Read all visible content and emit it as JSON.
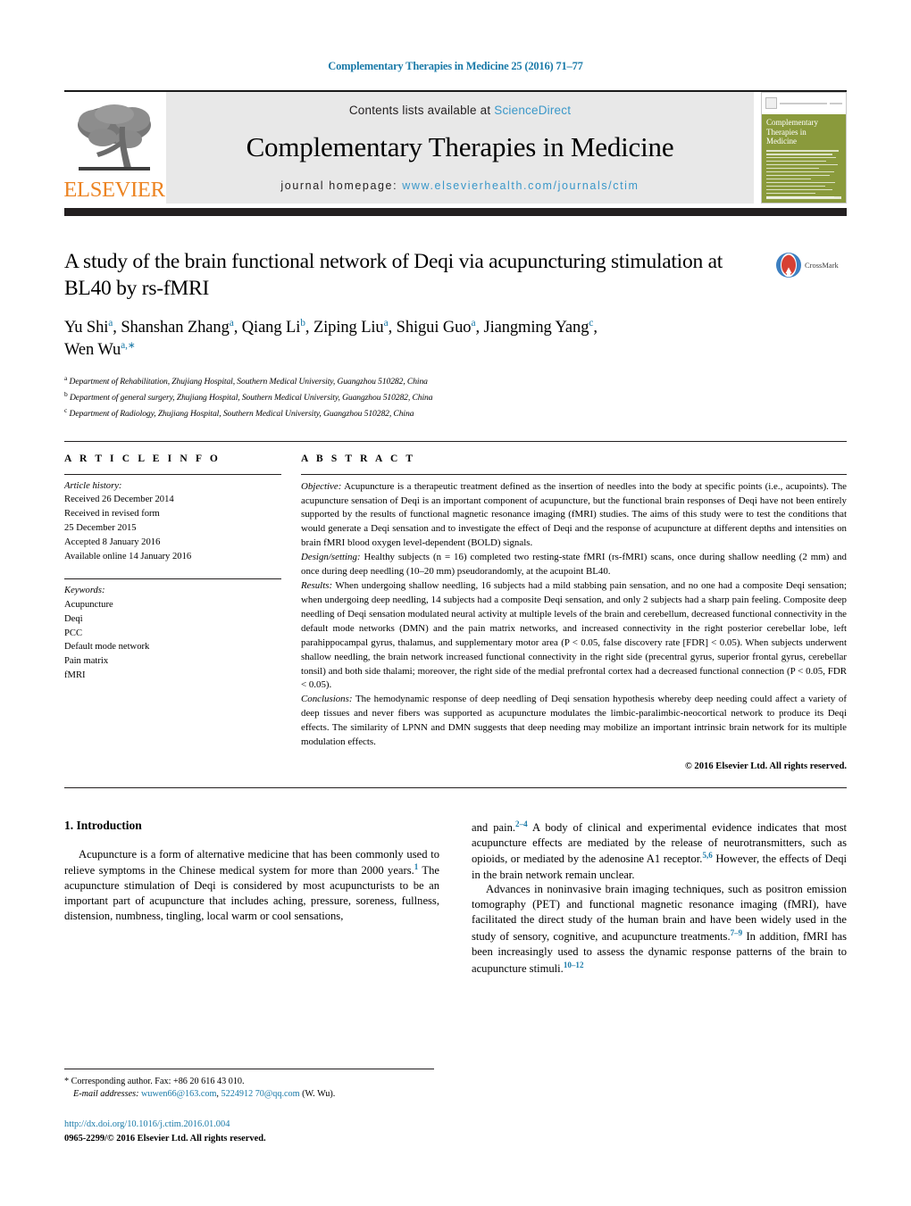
{
  "running_head": "Complementary Therapies in Medicine 25 (2016) 71–77",
  "masthead": {
    "publisher_name": "ELSEVIER",
    "contents_prefix": "Contents lists available at ",
    "contents_link": "ScienceDirect",
    "journal_title": "Complementary Therapies in Medicine",
    "homepage_prefix": "journal homepage: ",
    "homepage_url": "www.elsevierhealth.com/journals/ctim",
    "cover_title": "Complementary\nTherapies in\nMedicine",
    "colors": {
      "link": "#3a97c9",
      "running_head": "#1a7aa8",
      "elsevier_orange": "#ec8321",
      "cover_green": "#8a9a3c",
      "box_gray": "#e8e8e8"
    }
  },
  "article": {
    "title": "A study of the brain functional network of Deqi via acupuncturing stimulation at BL40 by rs-fMRI",
    "crossmark_label": "CrossMark",
    "authors_line1": "Yu Shi a, Shanshan Zhang a, Qiang Li b, Ziping Liu a, Shigui Guo a, Jiangming Yang c,",
    "authors_line2": "Wen Wu a,*",
    "affiliations": [
      "Department of Rehabilitation, Zhujiang Hospital, Southern Medical University, Guangzhou 510282, China",
      "Department of general surgery, Zhujiang Hospital, Southern Medical University, Guangzhou 510282, China",
      "Department of Radiology, Zhujiang Hospital, Southern Medical University, Guangzhou 510282, China"
    ],
    "affiliation_marks": [
      "a",
      "b",
      "c"
    ]
  },
  "article_info": {
    "heading": "A R T I C L E   I N F O",
    "history_label": "Article history:",
    "history": [
      "Received 26 December 2014",
      "Received in revised form",
      "25 December 2015",
      "Accepted 8 January 2016",
      "Available online 14 January 2016"
    ],
    "keywords_label": "Keywords:",
    "keywords": [
      "Acupuncture",
      "Deqi",
      "PCC",
      "Default mode network",
      "Pain matrix",
      "fMRI"
    ]
  },
  "abstract": {
    "heading": "A B S T R A C T",
    "objective_label": "Objective:",
    "objective_text": " Acupuncture is a therapeutic treatment defined as the insertion of needles into the body at specific points (i.e., acupoints). The acupuncture sensation of Deqi is an important component of acupuncture, but the functional brain responses of Deqi have not been entirely supported by the results of functional magnetic resonance imaging (fMRI) studies. The aims of this study were to test the conditions that would generate a Deqi sensation and to investigate the effect of Deqi and the response of acupuncture at different depths and intensities on brain fMRI blood oxygen level-dependent (BOLD) signals.",
    "design_label": "Design/setting:",
    "design_text": " Healthy subjects (n = 16) completed two resting-state fMRI (rs-fMRI) scans, once during shallow needling (2 mm) and once during deep needling (10–20 mm) pseudorandomly, at the acupoint BL40.",
    "results_label": "Results:",
    "results_text": " When undergoing shallow needling, 16 subjects had a mild stabbing pain sensation, and no one had a composite Deqi sensation; when undergoing deep needling, 14 subjects had a composite Deqi sensation, and only 2 subjects had a sharp pain feeling. Composite deep needling of Deqi sensation modulated neural activity at multiple levels of the brain and cerebellum, decreased functional connectivity in the default mode networks (DMN) and the pain matrix networks, and increased connectivity in the right posterior cerebellar lobe, left parahippocampal gyrus, thalamus, and supplementary motor area (P < 0.05, false discovery rate [FDR] < 0.05). When subjects underwent shallow needling, the brain network increased functional connectivity in the right side (precentral gyrus, superior frontal gyrus, cerebellar tonsil) and both side thalami; moreover, the right side of the medial prefrontal cortex had a decreased functional connection (P < 0.05, FDR < 0.05).",
    "conclusions_label": "Conclusions:",
    "conclusions_text": " The hemodynamic response of deep needling of Deqi sensation hypothesis whereby deep needing could affect a variety of deep tissues and never fibers was supported as acupuncture modulates the limbic-paralimbic-neocortical network to produce its Deqi effects. The similarity of LPNN and DMN suggests that deep needing may mobilize an important intrinsic brain network for its multiple modulation effects.",
    "copyright": "© 2016 Elsevier Ltd. All rights reserved."
  },
  "introduction": {
    "heading": "1.  Introduction",
    "left_para_1": "Acupuncture is a form of alternative medicine that has been commonly used to relieve symptoms in the Chinese medical system for more than 2000 years.",
    "left_para_1_ref": "1",
    "left_para_1_cont": " The acupuncture stimulation of Deqi is considered by most acupuncturists to be an important part of acupuncture that includes aching, pressure, soreness, fullness, distension, numbness, tingling, local warm or cool sensations,",
    "right_para_1_a": "and pain.",
    "right_para_1_ref_a": "2–4",
    "right_para_1_b": " A body of clinical and experimental evidence indicates that most acupuncture effects are mediated by the release of neurotransmitters, such as opioids, or mediated by the adenosine A1 receptor.",
    "right_para_1_ref_b": "5,6",
    "right_para_1_c": " However, the effects of Deqi in the brain network remain unclear.",
    "right_para_2_a": "Advances in noninvasive brain imaging techniques, such as positron emission tomography (PET) and functional magnetic resonance imaging (fMRI), have facilitated the direct study of the human brain and have been widely used in the study of sensory, cognitive, and acupuncture treatments.",
    "right_para_2_ref_a": "7–9",
    "right_para_2_b": " In addition, fMRI has been increasingly used to assess the dynamic response patterns of the brain to acupuncture stimuli.",
    "right_para_2_ref_b": "10–12"
  },
  "footer": {
    "corresponding_marker": "*",
    "corresponding_text": " Corresponding author. Fax: +86 20 616 43 010.",
    "email_label": "E-mail addresses:",
    "email_1": "wuwen66@163.com",
    "email_2": "5224912 70@qq.com",
    "email_suffix": " (W. Wu).",
    "doi": "http://dx.doi.org/10.1016/j.ctim.2016.01.004",
    "issn": "0965-2299/© 2016 Elsevier Ltd. All rights reserved."
  }
}
